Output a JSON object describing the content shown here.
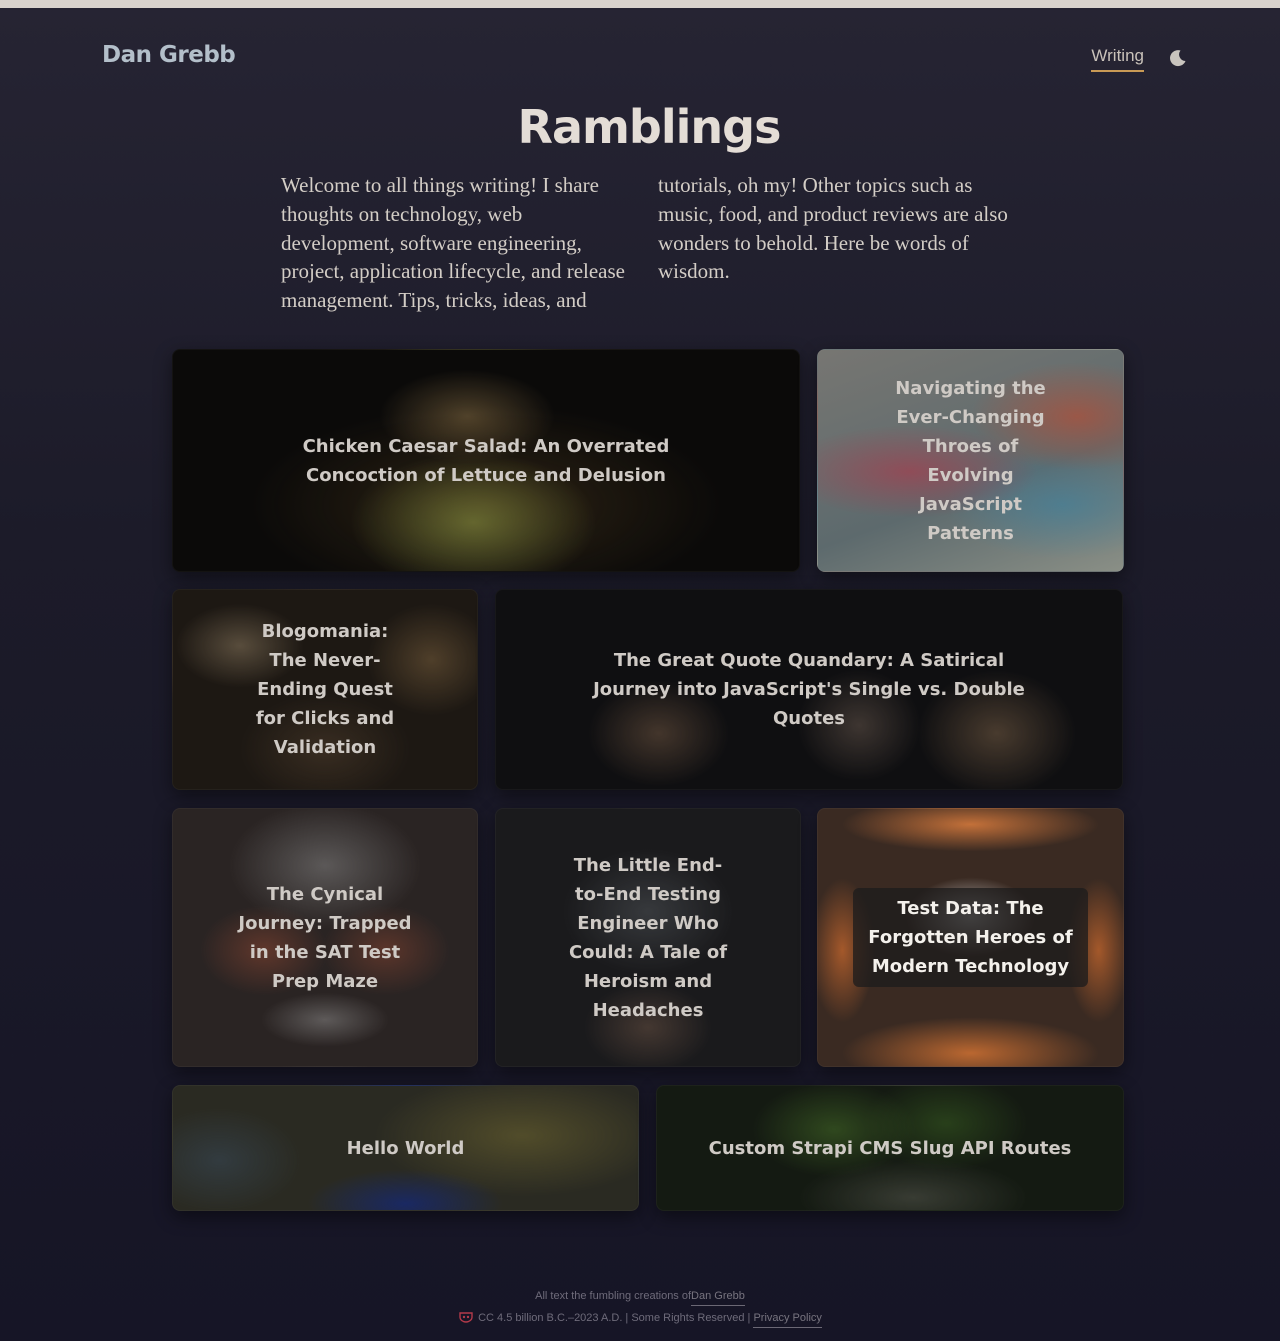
{
  "header": {
    "site_name": "Dan Grebb",
    "nav_link": "Writing",
    "theme_icon": "moon-icon"
  },
  "page": {
    "title": "Ramblings",
    "intro": "Welcome to all things writing! I share thoughts on technology, web development, software engineering, project, application lifecycle, and release management. Tips, tricks, ideas, and tutorials, oh my! Other topics such as music, food, and product reviews are also wonders to behold. Here be words of wisdom."
  },
  "posts": [
    {
      "title": "Chicken Caesar Salad: An Overrated Concoction of Lettuce and Delusion"
    },
    {
      "title": "Navigating the Ever-Changing Throes of Evolving JavaScript Patterns"
    },
    {
      "title": "Blogomania: The Never-Ending Quest for Clicks and Validation"
    },
    {
      "title": "The Great Quote Quandary: A Satirical Journey into JavaScript's Single vs. Double Quotes"
    },
    {
      "title": "The Cynical Journey: Trapped in the SAT Test Prep Maze"
    },
    {
      "title": "The Little End-to-End Testing Engineer Who Could: A Tale of Heroism and Headaches"
    },
    {
      "title": "Test Data: The Forgotten Heroes of Modern Technology"
    },
    {
      "title": "Hello World"
    },
    {
      "title": "Custom Strapi CMS Slug API Routes"
    }
  ],
  "footer": {
    "text_prefix": "All text the fumbling creations of",
    "author_link": "Dan Grebb",
    "license_icon": "creative-commons-icon",
    "license_text": "CC 4.5 billion B.C.–2023 A.D. | Some Rights Reserved |",
    "privacy_link": "Privacy Policy"
  }
}
